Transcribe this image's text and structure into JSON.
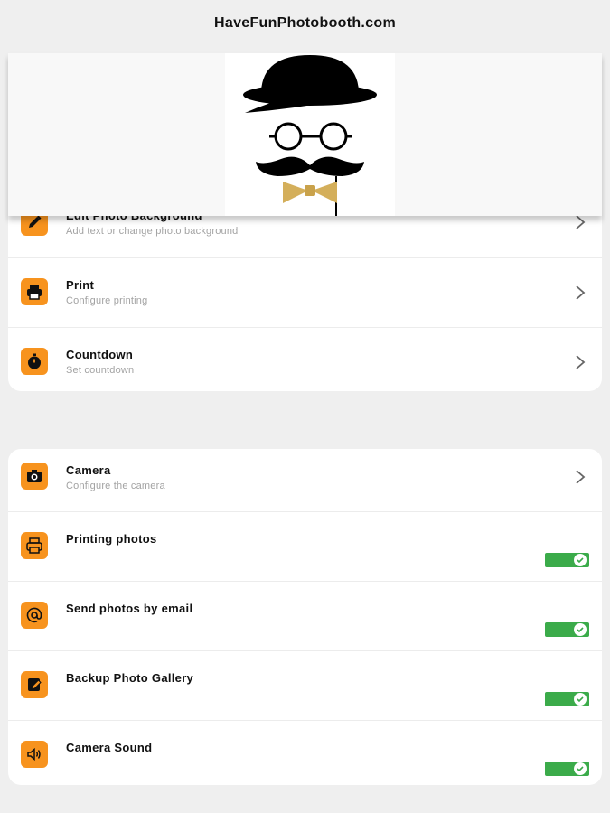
{
  "header": {
    "title": "HaveFunPhotobooth.com"
  },
  "banner": {
    "logo_icon": "mustache-gentleman-logo"
  },
  "section1": {
    "items": [
      {
        "title": "Edit Photo Background",
        "subtitle": "Add text or change photo background",
        "icon": "pencil-icon"
      },
      {
        "title": "Print",
        "subtitle": "Configure printing",
        "icon": "printer-icon"
      },
      {
        "title": "Countdown",
        "subtitle": "Set countdown",
        "icon": "timer-icon"
      }
    ]
  },
  "section2": {
    "items": [
      {
        "title": "Camera",
        "subtitle": "Configure the camera",
        "icon": "camera-icon"
      },
      {
        "title": "Printing photos",
        "icon": "printer-icon",
        "enabled": true
      },
      {
        "title": "Send photos by email",
        "icon": "at-sign-icon",
        "enabled": true
      },
      {
        "title": "Backup Photo Gallery",
        "icon": "gallery-edit-icon",
        "enabled": true
      },
      {
        "title": "Camera Sound",
        "icon": "speaker-icon",
        "enabled": true
      }
    ]
  },
  "colors": {
    "accent": "#f7931e",
    "toggle_on": "#3bab4a",
    "background": "#efefef"
  }
}
